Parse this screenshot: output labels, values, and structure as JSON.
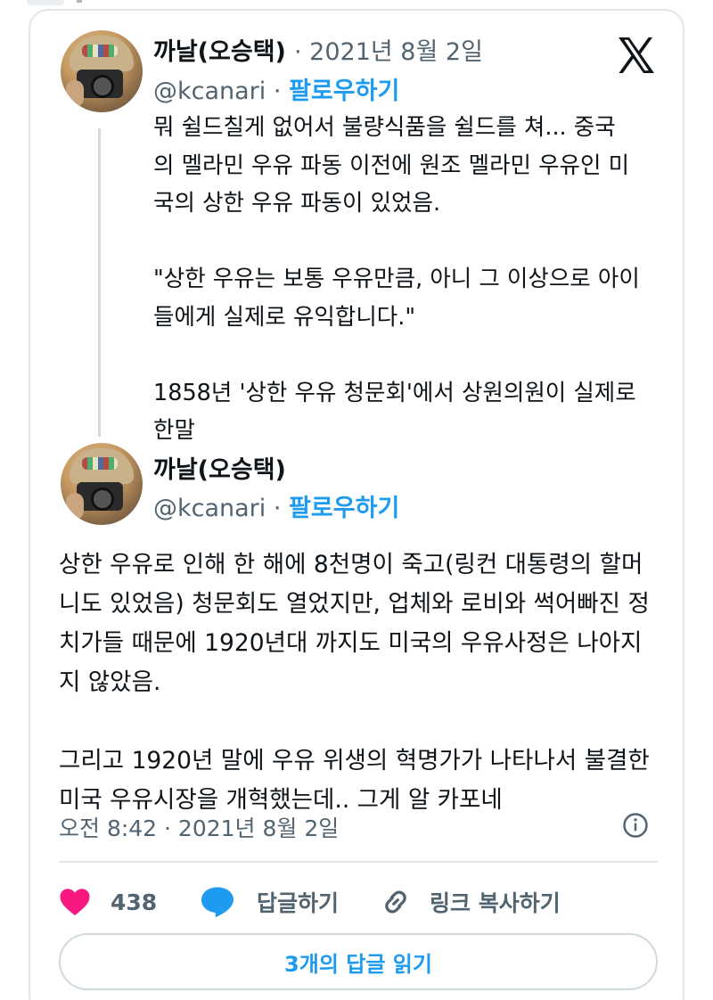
{
  "tweet_main": {
    "author_name": "까날(오승택)",
    "date_meta": "· 2021년 8월 2일",
    "handle": "@kcanari",
    "separator": "·",
    "follow_label": "팔로우하기",
    "lines": [
      "뭐 쉴드칠게 없어서 불량식품을 쉴드를 쳐... 중국",
      "의 멜라민 우유 파동 이전에 원조 멜라민 우유인 미",
      "국의 상한 우유 파동이 있었음.",
      "",
      "\"상한 우유는 보통 우유만큼, 아니 그 이상으로 아이",
      "들에게 실제로 유익합니다.\"",
      "",
      "1858년 '상한 우유 청문회'에서 상원의원이 실제로",
      "한말"
    ]
  },
  "tweet_reply": {
    "author_name": "까날(오승택)",
    "handle": "@kcanari",
    "separator": "·",
    "follow_label": "팔로우하기",
    "lines": [
      "상한 우유로 인해 한 해에 8천명이 죽고(링컨 대통령의 할머",
      "니도 있었음) 청문회도 열었지만, 업체와 로비와 썩어빠진 정",
      "치가들 때문에 1920년대 까지도 미국의 우유사정은 나아지",
      "지 않았음.",
      "",
      "그리고 1920년 말에 우유 위생의 혁명가가 나타나서 불결한",
      "미국 우유시장을 개혁했는데.. 그게 알 카포네"
    ],
    "timestamp": "오전 8:42 · 2021년 8월 2일"
  },
  "actions": {
    "like_count": "438",
    "reply_label": "답글하기",
    "copy_link_label": "링크 복사하기",
    "read_replies_label": "3개의 답글 읽기"
  },
  "colors": {
    "like": "#f91880",
    "reply": "#1d9bf0",
    "link": "#1d9bf0",
    "secondary_text": "#536471"
  },
  "icons": {
    "brand": "x-logo-icon",
    "like": "heart-icon",
    "reply": "speech-bubble-icon",
    "copy": "link-icon",
    "info": "info-icon"
  }
}
